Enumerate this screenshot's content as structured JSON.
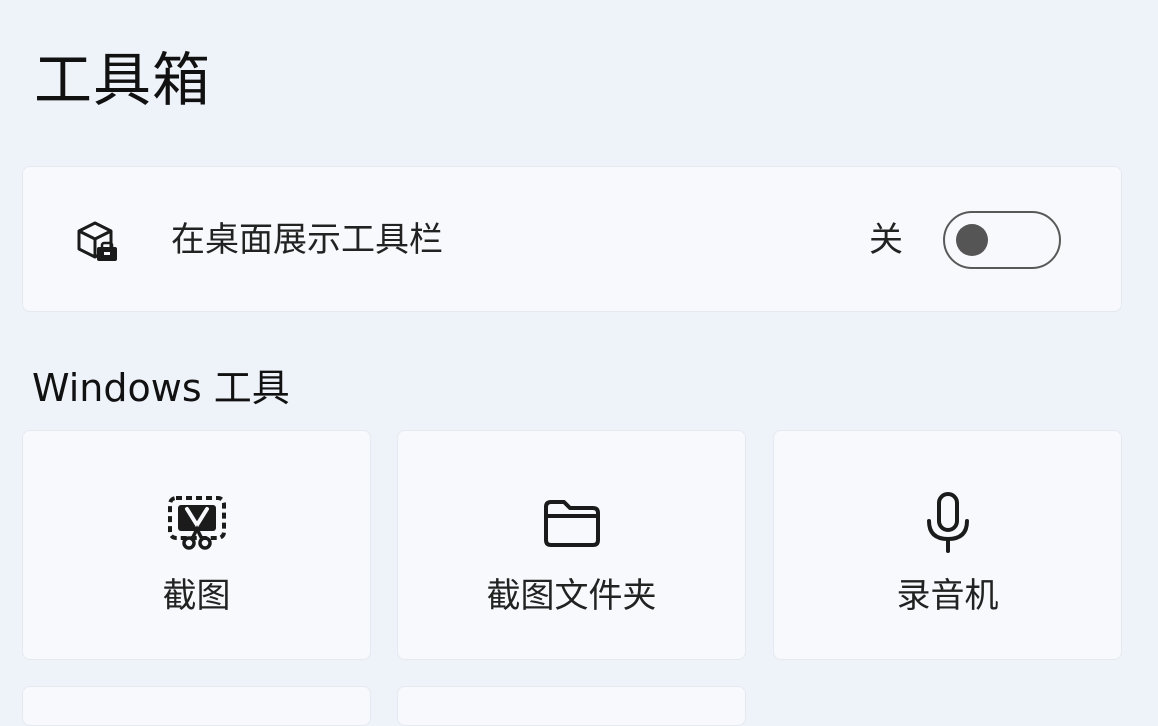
{
  "page": {
    "title": "工具箱"
  },
  "toolbar_setting": {
    "icon": "toolbox-icon",
    "label": "在桌面展示工具栏",
    "state_label": "关",
    "enabled": false
  },
  "windows_tools": {
    "heading": "Windows 工具",
    "items": [
      {
        "icon": "snipping-tool-icon",
        "label": "截图"
      },
      {
        "icon": "folder-icon",
        "label": "截图文件夹"
      },
      {
        "icon": "microphone-icon",
        "label": "录音机"
      }
    ]
  }
}
